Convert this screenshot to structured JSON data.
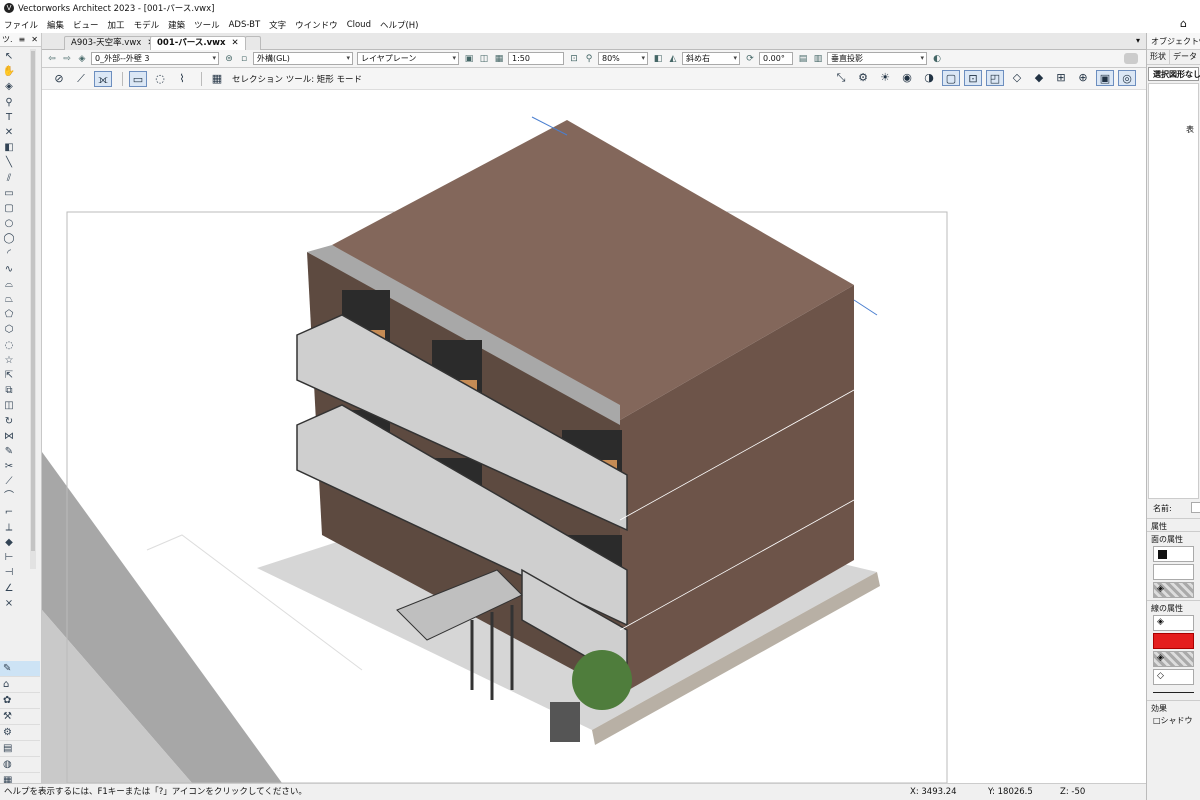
{
  "window": {
    "title": "Vectorworks Architect 2023 - [001-パース.vwx]",
    "logo": "V"
  },
  "menu": [
    "ファイル",
    "編集",
    "ビュー",
    "加工",
    "モデル",
    "建築",
    "ツール",
    "ADS-BT",
    "文字",
    "ウインドウ",
    "Cloud",
    "ヘルプ(H)"
  ],
  "palette": {
    "header": [
      "ツ.",
      "≡",
      "✕"
    ]
  },
  "tabs": [
    {
      "label": "A903-天空率.vwx",
      "active": false
    },
    {
      "label": "001-パース.vwx",
      "active": true
    }
  ],
  "viewbar": {
    "class_value": "0_外部--外壁 3",
    "layer_value": "外構(GL)",
    "plane_value": "レイヤプレーン",
    "scale_value": "1:50",
    "zoom_value": "80%",
    "view_value": "斜め右",
    "angle_value": "0.00°",
    "projection_value": "垂直投影"
  },
  "modebar": {
    "label": "セレクション ツール: 矩形 モード"
  },
  "statusbar": {
    "help": "ヘルプを表示するには、F1キーまたは「?」アイコンをクリックしてください。",
    "x": "X: 3493.24",
    "y": "Y: 18026.5",
    "z": "Z: -50"
  },
  "obj_panel": {
    "title": "オブジェクト情報",
    "tabs": [
      "形状",
      "データ"
    ],
    "selection": "選択図形なし",
    "mark": "表",
    "name_label": "名前:",
    "attr_header": "属性",
    "fill_label": "面の属性",
    "line_label": "線の属性",
    "effect_label": "効果",
    "shadow_label": "□シャドウ"
  },
  "colors": {
    "accent": "#cde3f5",
    "wall": "#6d5449",
    "roof": "#83675b",
    "line_attr": "#e41e1e"
  }
}
